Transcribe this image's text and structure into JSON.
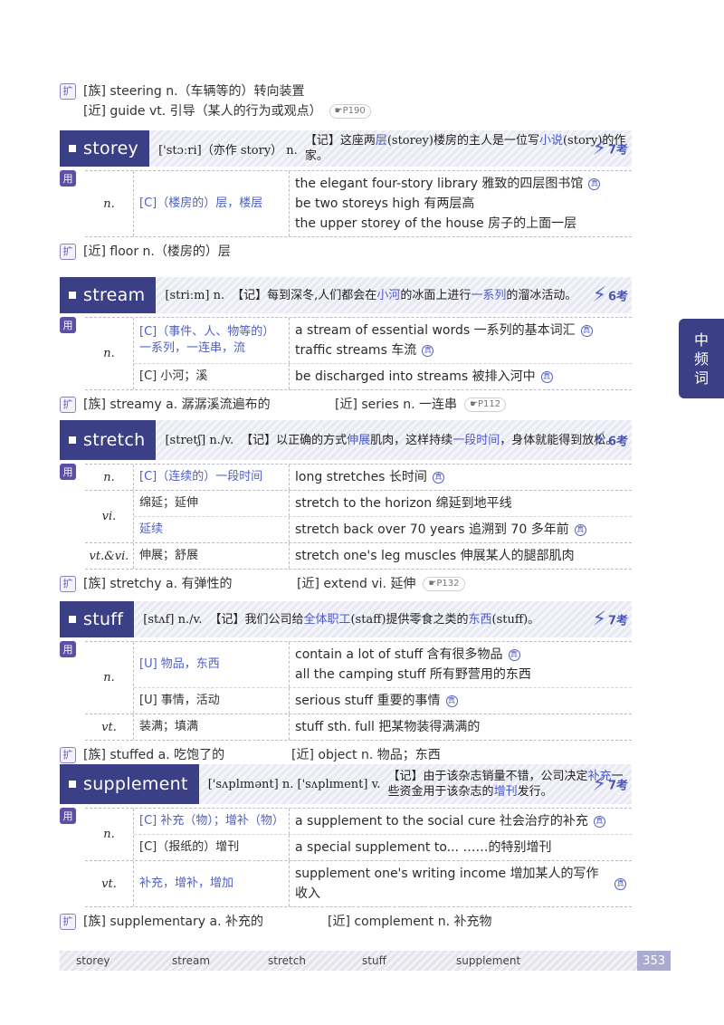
{
  "top_ext": {
    "icon": "扩",
    "line1": "[族] steering n.（车辆等的）转向装置",
    "line2": "[近] guide vt. 引导（某人的行为或观点）",
    "ref": "☛P190"
  },
  "labels": {
    "use": "用",
    "ext": "扩",
    "exam_mark": "真"
  },
  "entries": [
    {
      "word": "storey",
      "phonetic": "['stɔːri]（亦作 story） n.",
      "mem_a": "【记】这座两",
      "mem_em1": "层",
      "mem_b": "(storey)楼房的主人是一位写",
      "mem_em2": "小说",
      "mem_c": "(story)的作家。",
      "freq": "7考",
      "rows": [
        {
          "pos": "n.",
          "senses": [
            {
              "def": "[C]（楼房的）层，楼层",
              "ex": [
                "the elegant four-story library 雅致的四层图书馆",
                "be two storeys high 有两层高",
                "the upper storey of the house 房子的上面一层"
              ]
            }
          ]
        }
      ],
      "ext_left": "[近] floor n.（楼房的）层"
    },
    {
      "word": "stream",
      "phonetic": "[striːm] n.",
      "mem_a": "【记】每到深冬,人们都会在",
      "mem_em1": "小河",
      "mem_b": "的冰面上进行",
      "mem_em2": "一系列",
      "mem_c": "的溜冰活动。",
      "freq": "6考",
      "rows": [
        {
          "pos": "n.",
          "senses": [
            {
              "def": "[C]（事件、人、物等的）一系列，一连串，流",
              "ex": [
                "a stream of essential words 一系列的基本词汇",
                "traffic streams 车流"
              ]
            },
            {
              "def": "[C] 小河；溪",
              "ex": [
                "be discharged into streams 被排入河中"
              ]
            }
          ]
        }
      ],
      "ext_left": "[族] streamy a. 潺潺溪流遍布的",
      "ext_right": "[近] series n. 一连串",
      "ext_ref": "☛P112"
    },
    {
      "word": "stretch",
      "phonetic": "[stretʃ] n./v.",
      "mem_a": "【记】以正确的方式",
      "mem_em1": "伸展",
      "mem_b": "肌肉，这样持续",
      "mem_em2": "一段时间",
      "mem_c": "，身体就能得到放松。",
      "freq": "6考",
      "rows": [
        {
          "pos": "n.",
          "senses": [
            {
              "def": "[C]（连续的）一段时间",
              "ex": [
                "long stretches 长时间"
              ]
            }
          ]
        },
        {
          "pos": "vi.",
          "senses": [
            {
              "def": "绵延；延伸",
              "ex": [
                "stretch to the horizon 绵延到地平线"
              ]
            },
            {
              "def": "延续",
              "ex": [
                "stretch back over 70 years 追溯到 70 多年前"
              ]
            }
          ]
        },
        {
          "pos": "vt.&vi.",
          "senses": [
            {
              "def": "伸展；舒展",
              "ex": [
                "stretch one's leg muscles 伸展某人的腿部肌肉"
              ]
            }
          ]
        }
      ],
      "ext_left": "[族] stretchy a. 有弹性的",
      "ext_right": "[近] extend vi. 延伸",
      "ext_ref": "☛P132"
    },
    {
      "word": "stuff",
      "phonetic": "[stʌf] n./v.",
      "mem_a": "【记】我们公司给",
      "mem_em1": "全体职工",
      "mem_b": "(staff)提供零食之类的",
      "mem_em2": "东西",
      "mem_c": "(stuff)。",
      "freq": "7考",
      "rows": [
        {
          "pos": "n.",
          "senses": [
            {
              "def": "[U] 物品，东西",
              "ex": [
                "contain a lot of stuff 含有很多物品",
                "all the camping stuff 所有野营用的东西"
              ]
            },
            {
              "def": "[U] 事情，活动",
              "ex": [
                "serious stuff 重要的事情"
              ]
            }
          ]
        },
        {
          "pos": "vt.",
          "senses": [
            {
              "def": "装满；填满",
              "ex": [
                "stuff sth. full 把某物装得满满的"
              ]
            }
          ]
        }
      ],
      "ext_left": "[族] stuffed a. 吃饱了的",
      "ext_right": "[近] object n. 物品；东西"
    },
    {
      "word": "supplement",
      "phonetic": "['sʌplɪmənt] n. ['sʌplɪment] v.",
      "mem_a": "【记】由于该杂志销量不错，公司决定",
      "mem_em1": "补充",
      "mem_b": "一些资金用于该杂志的",
      "mem_em2": "增刊",
      "mem_c": "发行。",
      "freq": "7考",
      "rows": [
        {
          "pos": "n.",
          "senses": [
            {
              "def": "[C] 补充（物）；增补（物）",
              "ex": [
                "a supplement to the social cure 社会治疗的补充"
              ]
            },
            {
              "def": "[C]（报纸的）增刊",
              "ex": [
                "a special supplement to... ……的特别增刊"
              ]
            }
          ]
        },
        {
          "pos": "vt.",
          "senses": [
            {
              "def": "补充，增补，增加",
              "ex": [
                "supplement one's writing income 增加某人的写作收入"
              ]
            }
          ]
        }
      ],
      "ext_left": "[族] supplementary a. 补充的",
      "ext_right": "[近] complement n. 补充物"
    }
  ],
  "side_tab": [
    "中",
    "频",
    "词"
  ],
  "footer": {
    "words": [
      "storey",
      "stream",
      "stretch",
      "stuff",
      "supplement"
    ],
    "page": "353"
  }
}
